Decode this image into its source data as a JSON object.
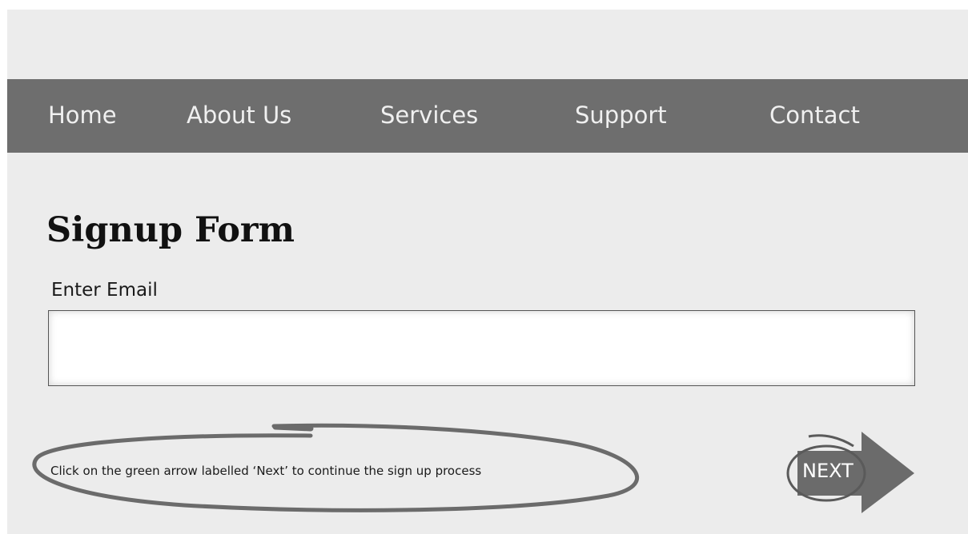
{
  "nav": {
    "items": [
      {
        "label": "Home"
      },
      {
        "label": "About Us"
      },
      {
        "label": "Services"
      },
      {
        "label": "Support"
      },
      {
        "label": "Contact"
      }
    ]
  },
  "form": {
    "title": "Signup Form",
    "email_label": "Enter Email",
    "email_value": "",
    "hint": "Click on the green arrow labelled ‘Next’ to continue the sign up process",
    "next_label": "NEXT"
  },
  "colors": {
    "page_background": "#ececec",
    "nav_background": "#6e6e6e",
    "nav_text": "#f0f0f0",
    "annotation_stroke": "#6b6b6b",
    "arrow_fill": "#6b6b6b"
  }
}
